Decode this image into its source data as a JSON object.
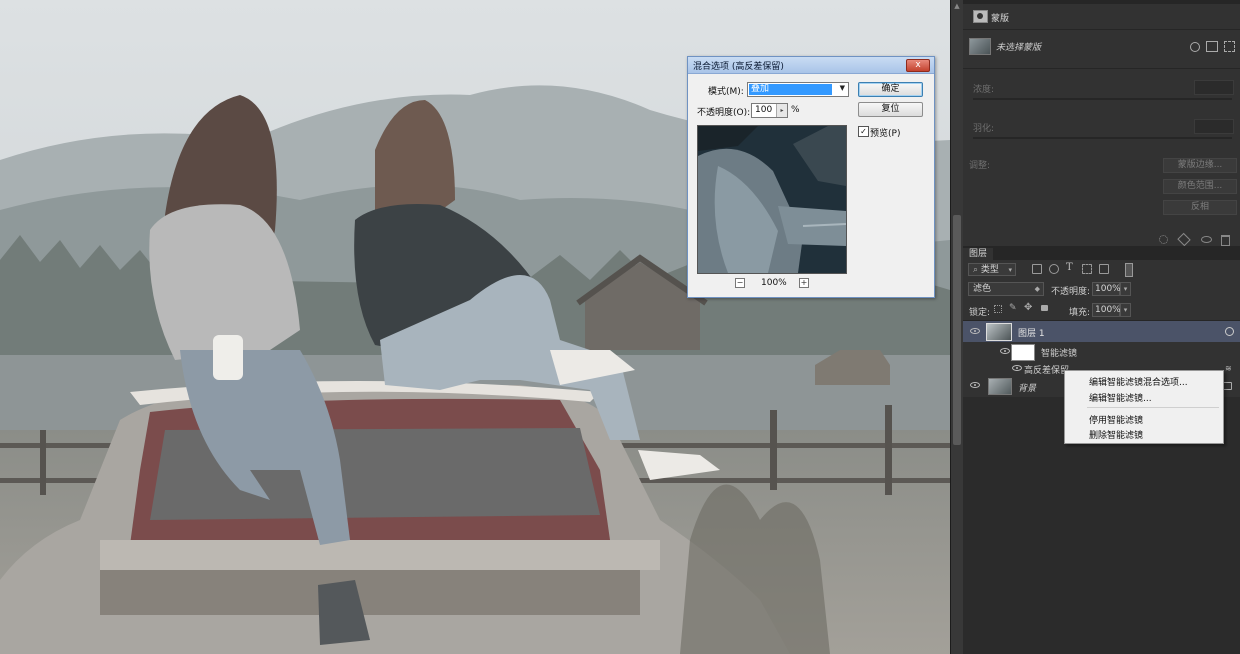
{
  "properties_panel": {
    "mask_label": "蒙版",
    "mask_status": "未选择蒙版",
    "density_label": "浓度:",
    "feather_label": "羽化:",
    "adjust_label": "调整:",
    "mask_edge_button": "蒙版边缘...",
    "color_range_button": "颜色范围...",
    "invert_button": "反相"
  },
  "layers_panel": {
    "tab_label": "图层",
    "filter_kind": "类型",
    "blend_mode": "滤色",
    "opacity_label": "不透明度:",
    "opacity_value": "100%",
    "lock_label": "锁定:",
    "fill_label": "填充:",
    "fill_value": "100%",
    "layers": [
      {
        "name": "图层 1"
      },
      {
        "name": "智能滤镜"
      },
      {
        "name": "高反差保留"
      },
      {
        "name": "背景"
      }
    ]
  },
  "dialog": {
    "title": "混合选项 (高反差保留)",
    "mode_label": "模式(M):",
    "mode_value": "叠加",
    "opacity_label": "不透明度(O):",
    "opacity_value": "100",
    "percent": "%",
    "ok_button": "确定",
    "reset_button": "复位",
    "preview_label": "预览(P)",
    "preview_checked": true,
    "zoom_value": "100%",
    "close_glyph": "x"
  },
  "context_menu": {
    "items": [
      "编辑智能滤镜混合选项...",
      "编辑智能滤镜...",
      "停用智能滤镜",
      "删除智能滤镜"
    ]
  }
}
